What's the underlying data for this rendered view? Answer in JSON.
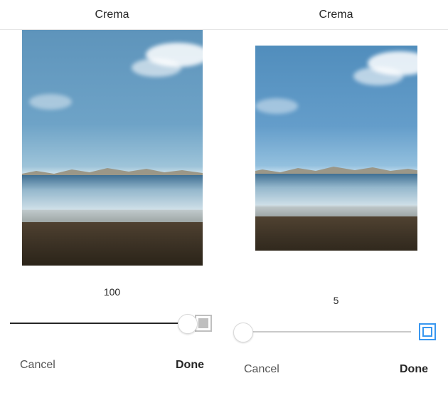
{
  "left": {
    "filter_name": "Crema",
    "slider_value": "100",
    "slider_percent": 100,
    "frame_enabled": false,
    "cancel_label": "Cancel",
    "done_label": "Done"
  },
  "right": {
    "filter_name": "Crema",
    "slider_value": "5",
    "slider_percent": 5,
    "frame_enabled": true,
    "cancel_label": "Cancel",
    "done_label": "Done"
  },
  "colors": {
    "accent": "#3897f0",
    "frame_border": "#ffffff"
  }
}
